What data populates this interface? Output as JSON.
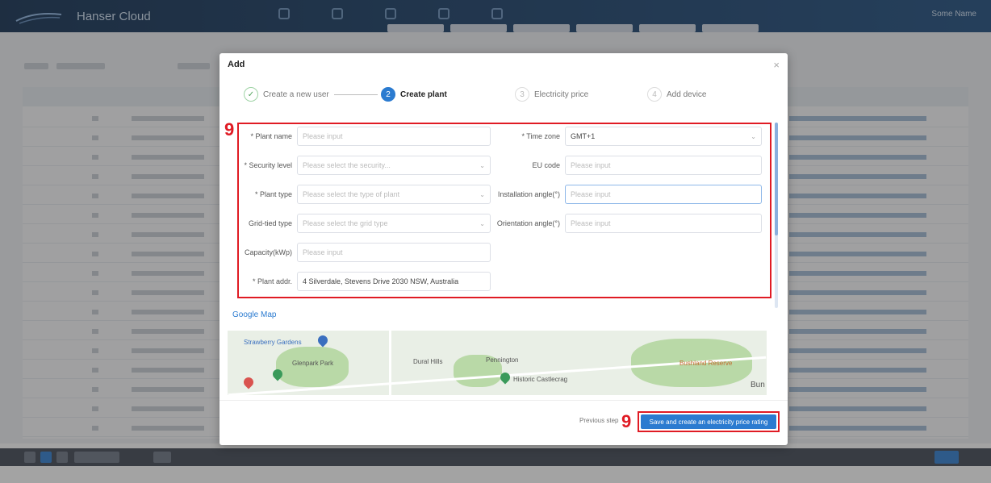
{
  "app": {
    "logo_text": "Hanser Cloud",
    "user": "Some Name"
  },
  "modal": {
    "title": "Add",
    "close_symbol": "×"
  },
  "steps": [
    {
      "label": "Create a new user",
      "state": "done",
      "icon": "check"
    },
    {
      "label": "Create plant",
      "state": "active",
      "number": "2"
    },
    {
      "label": "Electricity price",
      "state": "todo",
      "number": "3"
    },
    {
      "label": "Add device",
      "state": "todo",
      "number": "4"
    }
  ],
  "form": {
    "plant_name": {
      "label": "* Plant name",
      "placeholder": "Please input"
    },
    "time_zone": {
      "label": "* Time zone",
      "value": "GMT+1"
    },
    "security_level": {
      "label": "* Security level",
      "placeholder": "Please select the security..."
    },
    "eu_code": {
      "label": "EU code",
      "placeholder": "Please input"
    },
    "plant_type": {
      "label": "* Plant type",
      "placeholder": "Please select the type of plant"
    },
    "installation_angle": {
      "label": "Installation angle(°)",
      "placeholder": "Please input"
    },
    "grid_tied_type": {
      "label": "Grid-tied type",
      "placeholder": "Please select the grid type"
    },
    "orientation_angle": {
      "label": "Orientation angle(°)",
      "placeholder": "Please input"
    },
    "capacity": {
      "label": "Capacity(kWp)",
      "placeholder": "Please input"
    },
    "plant_addr": {
      "label": "* Plant addr.",
      "value": "4 Silverdale, Stevens Drive 2030 NSW, Australia"
    }
  },
  "google_map_link": "Google Map",
  "map_labels": {
    "place_one": "Strawberry Gardens",
    "place_two": "Glenpark Park",
    "place_three": "Dural Hills",
    "place_four": "Pennington",
    "place_five": "Historic Castlecrag",
    "place_six": "Bushland Reserve",
    "place_seven": "Bun"
  },
  "footer": {
    "previous_label": "Previous step",
    "save_label": "Save and create an electricity price rating"
  },
  "markers": {
    "form_marker": "9",
    "button_marker": "9"
  },
  "colors": {
    "primary": "#2b7bd0",
    "highlight": "#e01b24",
    "topbar": "#0d2b4e"
  }
}
